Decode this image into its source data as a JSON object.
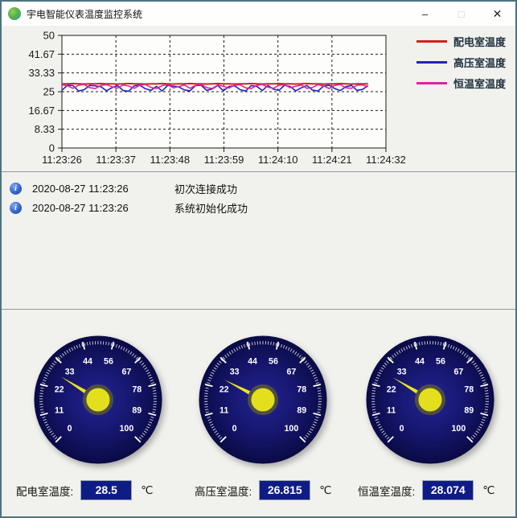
{
  "window": {
    "title": "宇电智能仪表温度监控系统",
    "controls": {
      "minimize": "–",
      "maximize": "□",
      "close": "✕"
    }
  },
  "chart_data": {
    "type": "line",
    "title": "",
    "xlabel": "",
    "ylabel": "",
    "ylim": [
      0,
      50
    ],
    "grid": true,
    "legend_position": "top-right",
    "x_ticks": [
      "11:23:26",
      "11:23:37",
      "11:23:48",
      "11:23:59",
      "11:24:10",
      "11:24:21",
      "11:24:32"
    ],
    "y_tick_labels": [
      "0",
      "8.33",
      "16.67",
      "25",
      "33.33",
      "41.67",
      "50"
    ],
    "series": [
      {
        "name": "配电室温度",
        "color": "#d42020",
        "values": [
          28.5,
          28.5,
          28.6,
          28.5,
          28.4,
          28.5,
          28.5,
          28.6,
          28.5,
          28.5,
          28.4,
          28.5,
          28.6,
          28.5,
          28.5,
          28.4,
          28.5,
          28.5,
          28.6,
          28.5,
          28.4,
          28.5,
          28.5,
          28.6,
          28.5,
          28.5,
          28.4,
          28.5,
          28.6,
          28.5,
          28.5,
          28.4,
          28.5,
          28.5,
          28.6,
          28.5,
          28.4,
          28.5,
          28.5,
          28.6,
          28.5,
          28.5,
          28.4,
          28.5,
          28.6,
          28.5,
          28.5,
          28.4,
          28.5,
          28.5,
          28.6,
          28.5,
          28.4,
          28.5,
          28.5,
          28.5
        ]
      },
      {
        "name": "高压室温度",
        "color": "#2222c4",
        "values": [
          25.6,
          27.9,
          27.7,
          25.3,
          25.9,
          27.8,
          27.6,
          27.2,
          25.4,
          26.8,
          27.7,
          25.5,
          25.2,
          27.6,
          27.9,
          26.3,
          25.6,
          27.4,
          25.3,
          27.8,
          27.5,
          27.1,
          25.8,
          25.4,
          27.7,
          27.9,
          25.6,
          26.2,
          27.8,
          25.4,
          27.3,
          27.6,
          25.9,
          25.3,
          27.7,
          27.4,
          25.5,
          27.8,
          26.1,
          25.6,
          27.9,
          27.3,
          25.4,
          26.7,
          27.8,
          25.7,
          25.3,
          27.5,
          27.9,
          26.4,
          25.5,
          27.2,
          27.8,
          25.6,
          26.0,
          27.7
        ]
      },
      {
        "name": "恒温室温度",
        "color": "#e2219e",
        "values": [
          28.1,
          27.6,
          26.5,
          27.9,
          28.2,
          26.8,
          26.4,
          27.8,
          28.1,
          27.2,
          26.6,
          28.0,
          27.5,
          26.5,
          27.9,
          28.2,
          26.9,
          26.4,
          27.7,
          28.1,
          26.7,
          27.3,
          28.0,
          26.5,
          27.8,
          28.2,
          26.8,
          26.4,
          28.0,
          27.4,
          26.6,
          27.9,
          28.1,
          26.7,
          26.4,
          27.8,
          28.2,
          27.0,
          26.5,
          27.9,
          28.1,
          26.8,
          27.4,
          28.0,
          26.5,
          26.9,
          28.1,
          27.6,
          26.4,
          27.8,
          28.2,
          26.7,
          26.5,
          27.9,
          28.0,
          27.2
        ]
      }
    ]
  },
  "log": {
    "entries": [
      {
        "time": "2020-08-27 11:23:26",
        "message": "初次连接成功"
      },
      {
        "time": "2020-08-27 11:23:26",
        "message": "系统初始化成功"
      }
    ]
  },
  "gauges": {
    "min": 0,
    "max": 100,
    "dial_labels": [
      "0",
      "11",
      "22",
      "33",
      "44",
      "56",
      "67",
      "78",
      "89",
      "100"
    ],
    "colors": {
      "face_center": "#232394",
      "face_edge": "#0a0a45",
      "needle": "#e9e520",
      "hub": "#e4df1d",
      "tick": "#ffffff"
    },
    "items": [
      {
        "label": "配电室温度:",
        "value": 28.5,
        "display": "28.5",
        "unit": "℃"
      },
      {
        "label": "高压室温度:",
        "value": 26.815,
        "display": "26.815",
        "unit": "℃"
      },
      {
        "label": "恒温室温度:",
        "value": 28.074,
        "display": "28.074",
        "unit": "℃"
      }
    ]
  }
}
